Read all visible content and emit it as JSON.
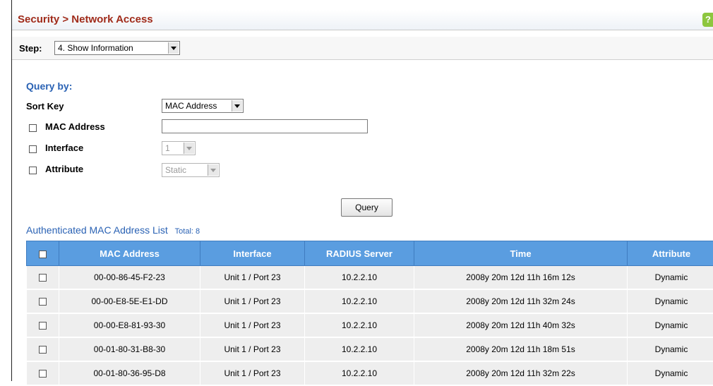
{
  "header": {
    "breadcrumb": "Security > Network Access",
    "help_glyph": "?"
  },
  "step": {
    "label": "Step:",
    "selected": "4. Show Information"
  },
  "query": {
    "title": "Query by:",
    "sort_key_label": "Sort Key",
    "sort_key_value": "MAC Address",
    "mac_label": "MAC Address",
    "mac_value": "",
    "interface_label": "Interface",
    "interface_value": "1",
    "attribute_label": "Attribute",
    "attribute_value": "Static",
    "button_label": "Query"
  },
  "list": {
    "title": "Authenticated MAC Address List",
    "total": "Total: 8",
    "columns": [
      "MAC Address",
      "Interface",
      "RADIUS Server",
      "Time",
      "Attribute"
    ],
    "rows": [
      {
        "mac": "00-00-86-45-F2-23",
        "interface": "Unit 1 / Port 23",
        "radius": "10.2.2.10",
        "time": "2008y 20m 12d 11h 16m 12s",
        "attribute": "Dynamic"
      },
      {
        "mac": "00-00-E8-5E-E1-DD",
        "interface": "Unit 1 / Port 23",
        "radius": "10.2.2.10",
        "time": "2008y 20m 12d 11h 32m 24s",
        "attribute": "Dynamic"
      },
      {
        "mac": "00-00-E8-81-93-30",
        "interface": "Unit 1 / Port 23",
        "radius": "10.2.2.10",
        "time": "2008y 20m 12d 11h 40m 32s",
        "attribute": "Dynamic"
      },
      {
        "mac": "00-01-80-31-B8-30",
        "interface": "Unit 1 / Port 23",
        "radius": "10.2.2.10",
        "time": "2008y 20m 12d 11h 18m 51s",
        "attribute": "Dynamic"
      },
      {
        "mac": "00-01-80-36-95-D8",
        "interface": "Unit 1 / Port 23",
        "radius": "10.2.2.10",
        "time": "2008y 20m 12d 11h 32m 22s",
        "attribute": "Dynamic"
      }
    ]
  },
  "colors": {
    "title_red": "#a02b1a",
    "section_blue": "#2a62b4",
    "table_header": "#5a9de0",
    "help_green": "#8dc63f"
  }
}
